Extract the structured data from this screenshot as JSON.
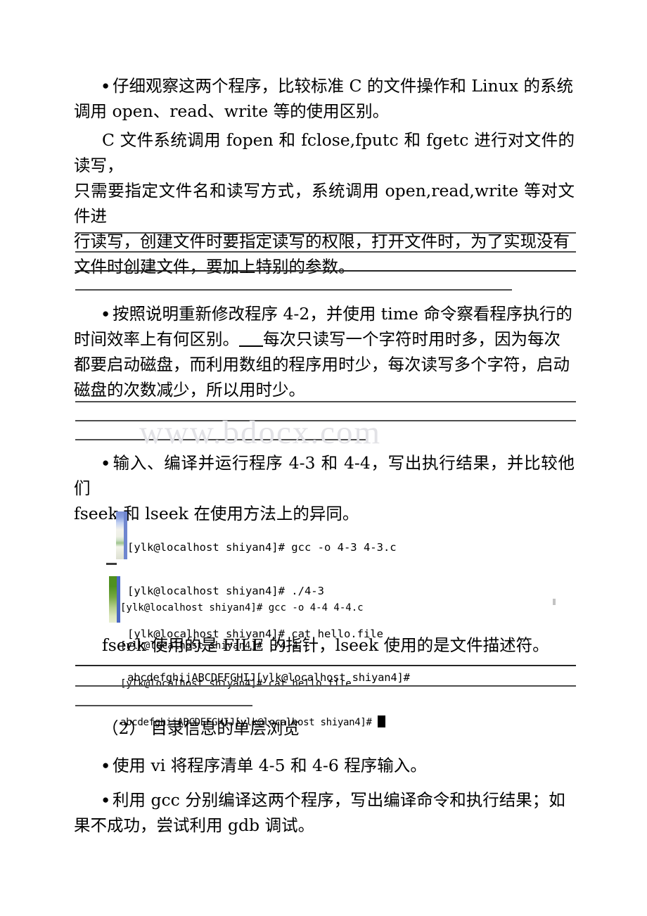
{
  "document": {
    "watermark": "www.bdocx.com",
    "paragraphs": {
      "p1_line1_bullet": "●",
      "p1": "仔细观察这两个程序，比较标准 C 的文件操作和 Linux 的系统调用 open、read、write 等的使用区别。",
      "p1_a": "仔细观察这两个程序，比较标准 C 的文件操作和 Linux 的系统",
      "p1_b": "调用 open、read、write 等的使用区别。",
      "p2_a": "C 文件系统调用 fopen 和 fclose,fputc 和 fgetc 进行对文件的读写，",
      "p2_b": "只需要指定文件名和读写方式，系统调用 open,read,write 等对文件进",
      "p2_c": "行读写，创建文件时要指定读写的权限，打开文件时，为了实现没有",
      "p2_d": "文件时创建文件，要加上特别的参数。",
      "p3_a": "按照说明重新修改程序 4-2，并使用 time 命令察看程序执行的",
      "p3_b1": "时间效率上有何区别。",
      "p3_b2": "每次只读写一个字符时用时多，因为每次",
      "p3_c": "都要启动磁盘，而利用数组的程序用时少，每次读写多个字符，启动",
      "p3_d": "磁盘的次数减少，所以用时少。",
      "p4_a": "输入、编译并运行程序 4-3 和 4-4，写出执行结果，并比较他们",
      "p4_b": "fseek 和 lseek 在使用方法上的异同。",
      "p5": "fseek 使用的是 FILE 的指针，lseek 使用的是文件描述符。",
      "p6": "（2） 目录信息的单层浏览",
      "p7": "使用 vi 将程序清单 4-5 和 4-6 程序输入。",
      "p8_a": "利用 gcc 分别编译这两个程序，写出编译命令和执行结果；如",
      "p8_b": "果不成功，尝试利用 gdb 调试。"
    },
    "terminal_1": {
      "line_1": "[ylk@localhost shiyan4]# gcc -o 4-3 4-3.c",
      "line_2": "[ylk@localhost shiyan4]# ./4-3",
      "line_3": "[ylk@localhost shiyan4]# cat hello.file",
      "line_4": "abcdefghijABCDEFGHIJ[ylk@localhost shiyan4]#"
    },
    "terminal_2": {
      "line_1": "[ylk@localhost shiyan4]# gcc -o 4-4 4-4.c",
      "line_2": "[ylk@localhost shiyan4]# ./4-4",
      "line_3": "[ylk@localhost shiyan4]# cat hello.file",
      "line_4": "abcdefghijABCDEFGHIJ[ylk@localhost shiyan4]# "
    },
    "colors": {
      "text": "#000000",
      "rule": "#4d4d4d",
      "watermark": "#e2e2e6",
      "bar_blue": "#6f86cf",
      "bar_green": "#4f8f1e"
    }
  }
}
